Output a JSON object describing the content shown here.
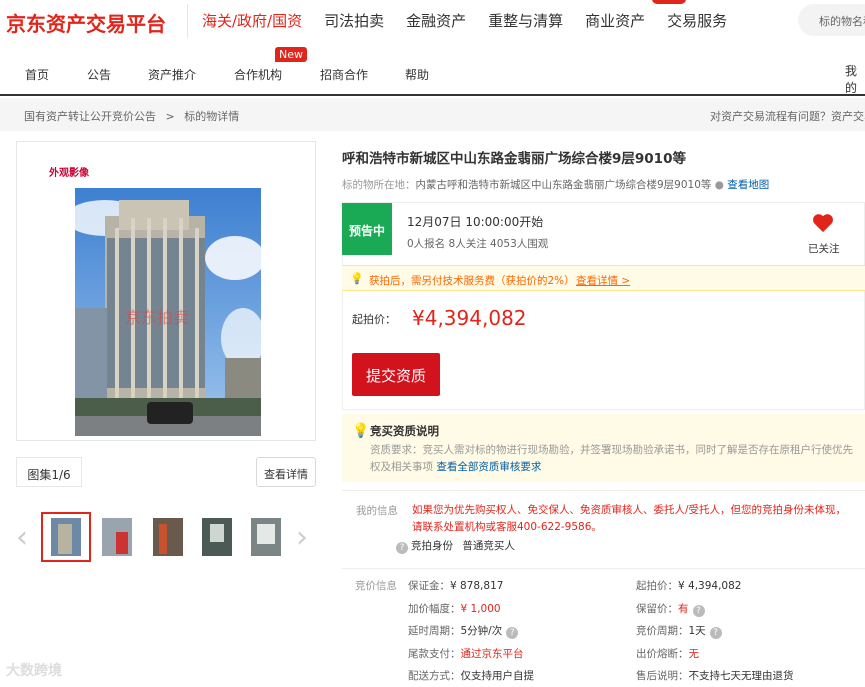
{
  "header": {
    "logo": "京东资产交易平台",
    "nav": [
      "海关/政府/国资",
      "司法拍卖",
      "金融资产",
      "重整与清算",
      "商业资产",
      "交易服务"
    ],
    "search_placeholder": "标的物名称"
  },
  "subnav": {
    "items": [
      "首页",
      "公告",
      "资产推介",
      "合作机构",
      "招商合作",
      "帮助"
    ],
    "new_badge": "New",
    "mine": "我的"
  },
  "breadcrumb": {
    "items": [
      "国有资产转让公开竞价公告",
      "标的物详情"
    ],
    "separator": ">",
    "help_text": "对资产交易流程有问题？资产交易"
  },
  "gallery": {
    "watermark_logo": "外观影像",
    "photo_watermark": "京东拍卖",
    "album_count": "图集1/6",
    "detail_button": "查看详情",
    "thumbs": 5
  },
  "item": {
    "title": "呼和浩特市新城区中山东路金翡丽广场综合楼9层9010等",
    "location_label": "标的物所在地：",
    "location": "内蒙古呼和浩特市新城区中山东路金翡丽广场综合楼9层9010等",
    "map_link": "查看地图"
  },
  "auction": {
    "status": "预告中",
    "start_time": "12月07日 10:00:00开始",
    "stats": "0人报名  8人关注  4053人围观",
    "fav_label": "已关注",
    "tip_text": "获拍后，需另付技术服务费（获拍价的2%）",
    "tip_link": "查看详情 >",
    "start_price_label": "起拍价：",
    "start_price": "¥4,394,082",
    "submit_button": "提交资质"
  },
  "qualification": {
    "title": "竞买资质说明",
    "body": "资质要求：竞买人需对标的物进行现场勘验，并签署现场勘验承诺书，同时了解是否存在原租户行使优先权及相关事项",
    "link": "查看全部资质审核要求"
  },
  "my_info": {
    "label": "我的信息",
    "message": "如果您为优先购买权人、免交保人、免资质审核人、委托人/受托人，但您的竞拍身份未体现，请联系处置机构或客服400-622-9586。",
    "bidder_label": "竞拍身份",
    "bidder_value": "普通竞买人"
  },
  "bid_info": {
    "label": "竞价信息",
    "left": [
      {
        "k": "保证金：",
        "v": "¥ 878,817",
        "red": false,
        "q": false
      },
      {
        "k": "加价幅度：",
        "v": "¥ 1,000",
        "red": true,
        "q": false
      },
      {
        "k": "延时周期：",
        "v": "5分钟/次",
        "red": false,
        "q": true
      },
      {
        "k": "尾款支付：",
        "v": "通过京东平台",
        "red": true,
        "q": false
      },
      {
        "k": "配送方式：",
        "v": "仅支持用户自提",
        "red": false,
        "q": false
      }
    ],
    "right": [
      {
        "k": "起拍价：",
        "v": "¥ 4,394,082",
        "red": false,
        "q": false
      },
      {
        "k": "保留价：",
        "v": "有",
        "red": true,
        "q": true
      },
      {
        "k": "竞价周期：",
        "v": "1天",
        "red": false,
        "q": true
      },
      {
        "k": "出价熔断：",
        "v": "无",
        "red": true,
        "q": false
      },
      {
        "k": "售后说明：",
        "v": "不支持七天无理由退货",
        "red": false,
        "q": false
      }
    ]
  },
  "footer_watermark": "大数跨境",
  "colors": {
    "brand_red": "#e1251b",
    "status_green": "#1aaa55",
    "link_blue": "#005ea7"
  }
}
